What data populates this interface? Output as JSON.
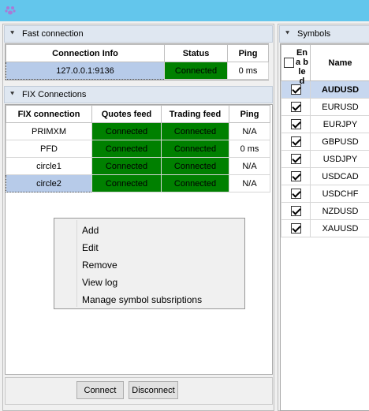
{
  "fast": {
    "header": "Fast connection",
    "columns": [
      "Connection Info",
      "Status",
      "Ping"
    ],
    "row": {
      "info": "127.0.0.1:9136",
      "status": "Connected",
      "ping": "0 ms"
    }
  },
  "fix": {
    "header": "FIX Connections",
    "columns": [
      "FIX connection",
      "Quotes feed",
      "Trading feed",
      "Ping"
    ],
    "rows": [
      {
        "name": "PRIMXM",
        "quotes": "Connected",
        "trading": "Connected",
        "ping": "N/A"
      },
      {
        "name": "PFD",
        "quotes": "Connected",
        "trading": "Connected",
        "ping": "0 ms"
      },
      {
        "name": "circle1",
        "quotes": "Connected",
        "trading": "Connected",
        "ping": "N/A"
      },
      {
        "name": "circle2",
        "quotes": "Connected",
        "trading": "Connected",
        "ping": "N/A"
      }
    ]
  },
  "context_menu": {
    "items": [
      "Add",
      "Edit",
      "Remove",
      "View log",
      "Manage symbol subsriptions"
    ]
  },
  "buttons": {
    "connect": "Connect",
    "disconnect": "Disconnect"
  },
  "symbols": {
    "header": "Symbols",
    "columns": {
      "enabled": "Ena ble d",
      "name": "Name"
    },
    "rows": [
      {
        "name": "AUDUSD",
        "checked": true
      },
      {
        "name": "EURUSD",
        "checked": true
      },
      {
        "name": "EURJPY",
        "checked": true
      },
      {
        "name": "GBPUSD",
        "checked": true
      },
      {
        "name": "USDJPY",
        "checked": true
      },
      {
        "name": "USDCAD",
        "checked": true
      },
      {
        "name": "USDCHF",
        "checked": true
      },
      {
        "name": "NZDUSD",
        "checked": true
      },
      {
        "name": "XAUUSD",
        "checked": true
      }
    ]
  },
  "colors": {
    "titlebar": "#63c6ec",
    "connected": "#008000",
    "selected": "#b7cbe9"
  },
  "icons": {
    "app": "paw-icon",
    "collapse": "double-chevron-down-icon"
  }
}
